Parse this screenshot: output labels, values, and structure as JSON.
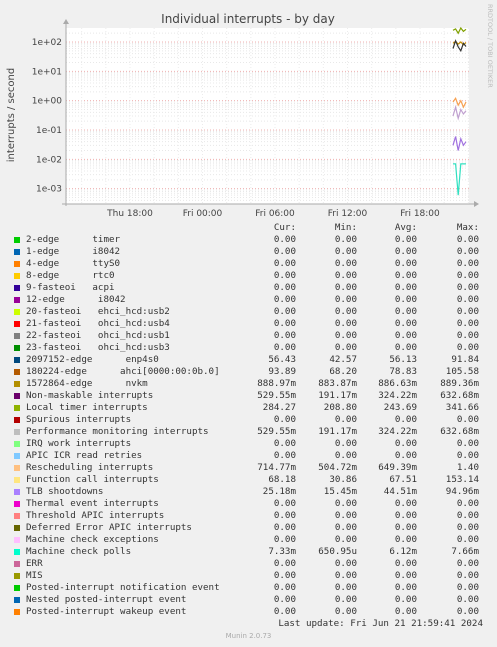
{
  "chart_data": {
    "type": "line",
    "title": "Individual interrupts - by day",
    "ylabel": "interrupts / second",
    "yscale": "log",
    "ylim": [
      0.0003,
      300
    ],
    "y_ticks": [
      {
        "value": 100,
        "label": "1e+02"
      },
      {
        "value": 10,
        "label": "1e+01"
      },
      {
        "value": 1,
        "label": "1e+00"
      },
      {
        "value": 0.1,
        "label": "1e-01"
      },
      {
        "value": 0.01,
        "label": "1e-02"
      },
      {
        "value": 0.001,
        "label": "1e-03"
      }
    ],
    "x_ticks": [
      "Thu 18:00",
      "Fri 00:00",
      "Fri 06:00",
      "Fri 12:00",
      "Fri 18:00"
    ],
    "grid": true,
    "series": [
      {
        "name": "180224-edge ahci[0000:00:0b.0]",
        "color": "#c09000",
        "values": [
          90,
          105,
          85,
          100,
          80,
          95
        ]
      },
      {
        "name": "Local timer interrupts",
        "color": "#80a000",
        "values": [
          250,
          280,
          200,
          300,
          230,
          270
        ]
      },
      {
        "name": "Function call interrupts",
        "color": "#333333",
        "values": [
          60,
          110,
          68,
          50,
          90,
          70
        ]
      },
      {
        "name": "Rescheduling interrupts",
        "color": "#f8a050",
        "values": [
          0.9,
          1.2,
          0.7,
          1.0,
          0.6,
          0.9
        ]
      },
      {
        "name": "Performance monitoring interrupts",
        "color": "#c0a0d0",
        "values": [
          0.3,
          0.6,
          0.25,
          0.5,
          0.35,
          0.45
        ]
      },
      {
        "name": "TLB shootdowns",
        "color": "#a070e0",
        "values": [
          0.03,
          0.06,
          0.02,
          0.05,
          0.03,
          0.04
        ]
      },
      {
        "name": "Machine check polls",
        "color": "#30e0c0",
        "values": [
          0.007,
          0.007,
          0.0006,
          0.007,
          0.007,
          0.007
        ]
      }
    ]
  },
  "watermark": "RRDTOOL / TOBI OETIKER",
  "legend": {
    "headers": [
      "Cur:",
      "Min:",
      "Avg:",
      "Max:"
    ],
    "rows": [
      {
        "name": "2-edge      timer",
        "color": "#00cc00",
        "cur": "0.00",
        "min": "0.00",
        "avg": "0.00",
        "max": "0.00"
      },
      {
        "name": "1-edge      i8042",
        "color": "#0066b3",
        "cur": "0.00",
        "min": "0.00",
        "avg": "0.00",
        "max": "0.00"
      },
      {
        "name": "4-edge      ttyS0",
        "color": "#ff8000",
        "cur": "0.00",
        "min": "0.00",
        "avg": "0.00",
        "max": "0.00"
      },
      {
        "name": "8-edge      rtc0",
        "color": "#ffcc00",
        "cur": "0.00",
        "min": "0.00",
        "avg": "0.00",
        "max": "0.00"
      },
      {
        "name": "9-fasteoi   acpi",
        "color": "#330099",
        "cur": "0.00",
        "min": "0.00",
        "avg": "0.00",
        "max": "0.00"
      },
      {
        "name": "12-edge      i8042",
        "color": "#990099",
        "cur": "0.00",
        "min": "0.00",
        "avg": "0.00",
        "max": "0.00"
      },
      {
        "name": "20-fasteoi   ehci_hcd:usb2",
        "color": "#ccff00",
        "cur": "0.00",
        "min": "0.00",
        "avg": "0.00",
        "max": "0.00"
      },
      {
        "name": "21-fasteoi   ohci_hcd:usb4",
        "color": "#ff0000",
        "cur": "0.00",
        "min": "0.00",
        "avg": "0.00",
        "max": "0.00"
      },
      {
        "name": "22-fasteoi   ohci_hcd:usb1",
        "color": "#808080",
        "cur": "0.00",
        "min": "0.00",
        "avg": "0.00",
        "max": "0.00"
      },
      {
        "name": "23-fasteoi   ohci_hcd:usb3",
        "color": "#008f00",
        "cur": "0.00",
        "min": "0.00",
        "avg": "0.00",
        "max": "0.00"
      },
      {
        "name": "2097152-edge      enp4s0",
        "color": "#00487d",
        "cur": "56.43",
        "min": "42.57",
        "avg": "56.13",
        "max": "91.84"
      },
      {
        "name": "180224-edge      ahci[0000:00:0b.0]",
        "color": "#b35a00",
        "cur": "93.89",
        "min": "68.20",
        "avg": "78.83",
        "max": "105.58"
      },
      {
        "name": "1572864-edge      nvkm",
        "color": "#b38f00",
        "cur": "888.97m",
        "min": "883.87m",
        "avg": "886.63m",
        "max": "889.36m"
      },
      {
        "name": "Non-maskable interrupts",
        "color": "#6b006b",
        "cur": "529.55m",
        "min": "191.17m",
        "avg": "324.22m",
        "max": "632.68m"
      },
      {
        "name": "Local timer interrupts",
        "color": "#8fb300",
        "cur": "284.27",
        "min": "208.80",
        "avg": "243.69",
        "max": "341.66"
      },
      {
        "name": "Spurious interrupts",
        "color": "#b30000",
        "cur": "0.00",
        "min": "0.00",
        "avg": "0.00",
        "max": "0.00"
      },
      {
        "name": "Performance monitoring interrupts",
        "color": "#bebebe",
        "cur": "529.55m",
        "min": "191.17m",
        "avg": "324.22m",
        "max": "632.68m"
      },
      {
        "name": "IRQ work interrupts",
        "color": "#80ff80",
        "cur": "0.00",
        "min": "0.00",
        "avg": "0.00",
        "max": "0.00"
      },
      {
        "name": "APIC ICR read retries",
        "color": "#80c9ff",
        "cur": "0.00",
        "min": "0.00",
        "avg": "0.00",
        "max": "0.00"
      },
      {
        "name": "Rescheduling interrupts",
        "color": "#ffc080",
        "cur": "714.77m",
        "min": "504.72m",
        "avg": "649.39m",
        "max": "1.40"
      },
      {
        "name": "Function call interrupts",
        "color": "#ffe680",
        "cur": "68.18",
        "min": "30.86",
        "avg": "67.51",
        "max": "153.14"
      },
      {
        "name": "TLB shootdowns",
        "color": "#aa80ff",
        "cur": "25.18m",
        "min": "15.45m",
        "avg": "44.51m",
        "max": "94.96m"
      },
      {
        "name": "Thermal event interrupts",
        "color": "#ee00cc",
        "cur": "0.00",
        "min": "0.00",
        "avg": "0.00",
        "max": "0.00"
      },
      {
        "name": "Threshold APIC interrupts",
        "color": "#ff8080",
        "cur": "0.00",
        "min": "0.00",
        "avg": "0.00",
        "max": "0.00"
      },
      {
        "name": "Deferred Error APIC interrupts",
        "color": "#666600",
        "cur": "0.00",
        "min": "0.00",
        "avg": "0.00",
        "max": "0.00"
      },
      {
        "name": "Machine check exceptions",
        "color": "#ffbfff",
        "cur": "0.00",
        "min": "0.00",
        "avg": "0.00",
        "max": "0.00"
      },
      {
        "name": "Machine check polls",
        "color": "#00ffcc",
        "cur": "7.33m",
        "min": "650.95u",
        "avg": "6.12m",
        "max": "7.66m"
      },
      {
        "name": "ERR",
        "color": "#cc6699",
        "cur": "0.00",
        "min": "0.00",
        "avg": "0.00",
        "max": "0.00"
      },
      {
        "name": "MIS",
        "color": "#999900",
        "cur": "0.00",
        "min": "0.00",
        "avg": "0.00",
        "max": "0.00"
      },
      {
        "name": "Posted-interrupt notification event",
        "color": "#00cc00",
        "cur": "0.00",
        "min": "0.00",
        "avg": "0.00",
        "max": "0.00"
      },
      {
        "name": "Nested posted-interrupt event",
        "color": "#0066b3",
        "cur": "0.00",
        "min": "0.00",
        "avg": "0.00",
        "max": "0.00"
      },
      {
        "name": "Posted-interrupt wakeup event",
        "color": "#ff8000",
        "cur": "0.00",
        "min": "0.00",
        "avg": "0.00",
        "max": "0.00"
      }
    ]
  },
  "last_update": "Last update: Fri Jun 21 21:59:41 2024",
  "footer": "Munin 2.0.73"
}
